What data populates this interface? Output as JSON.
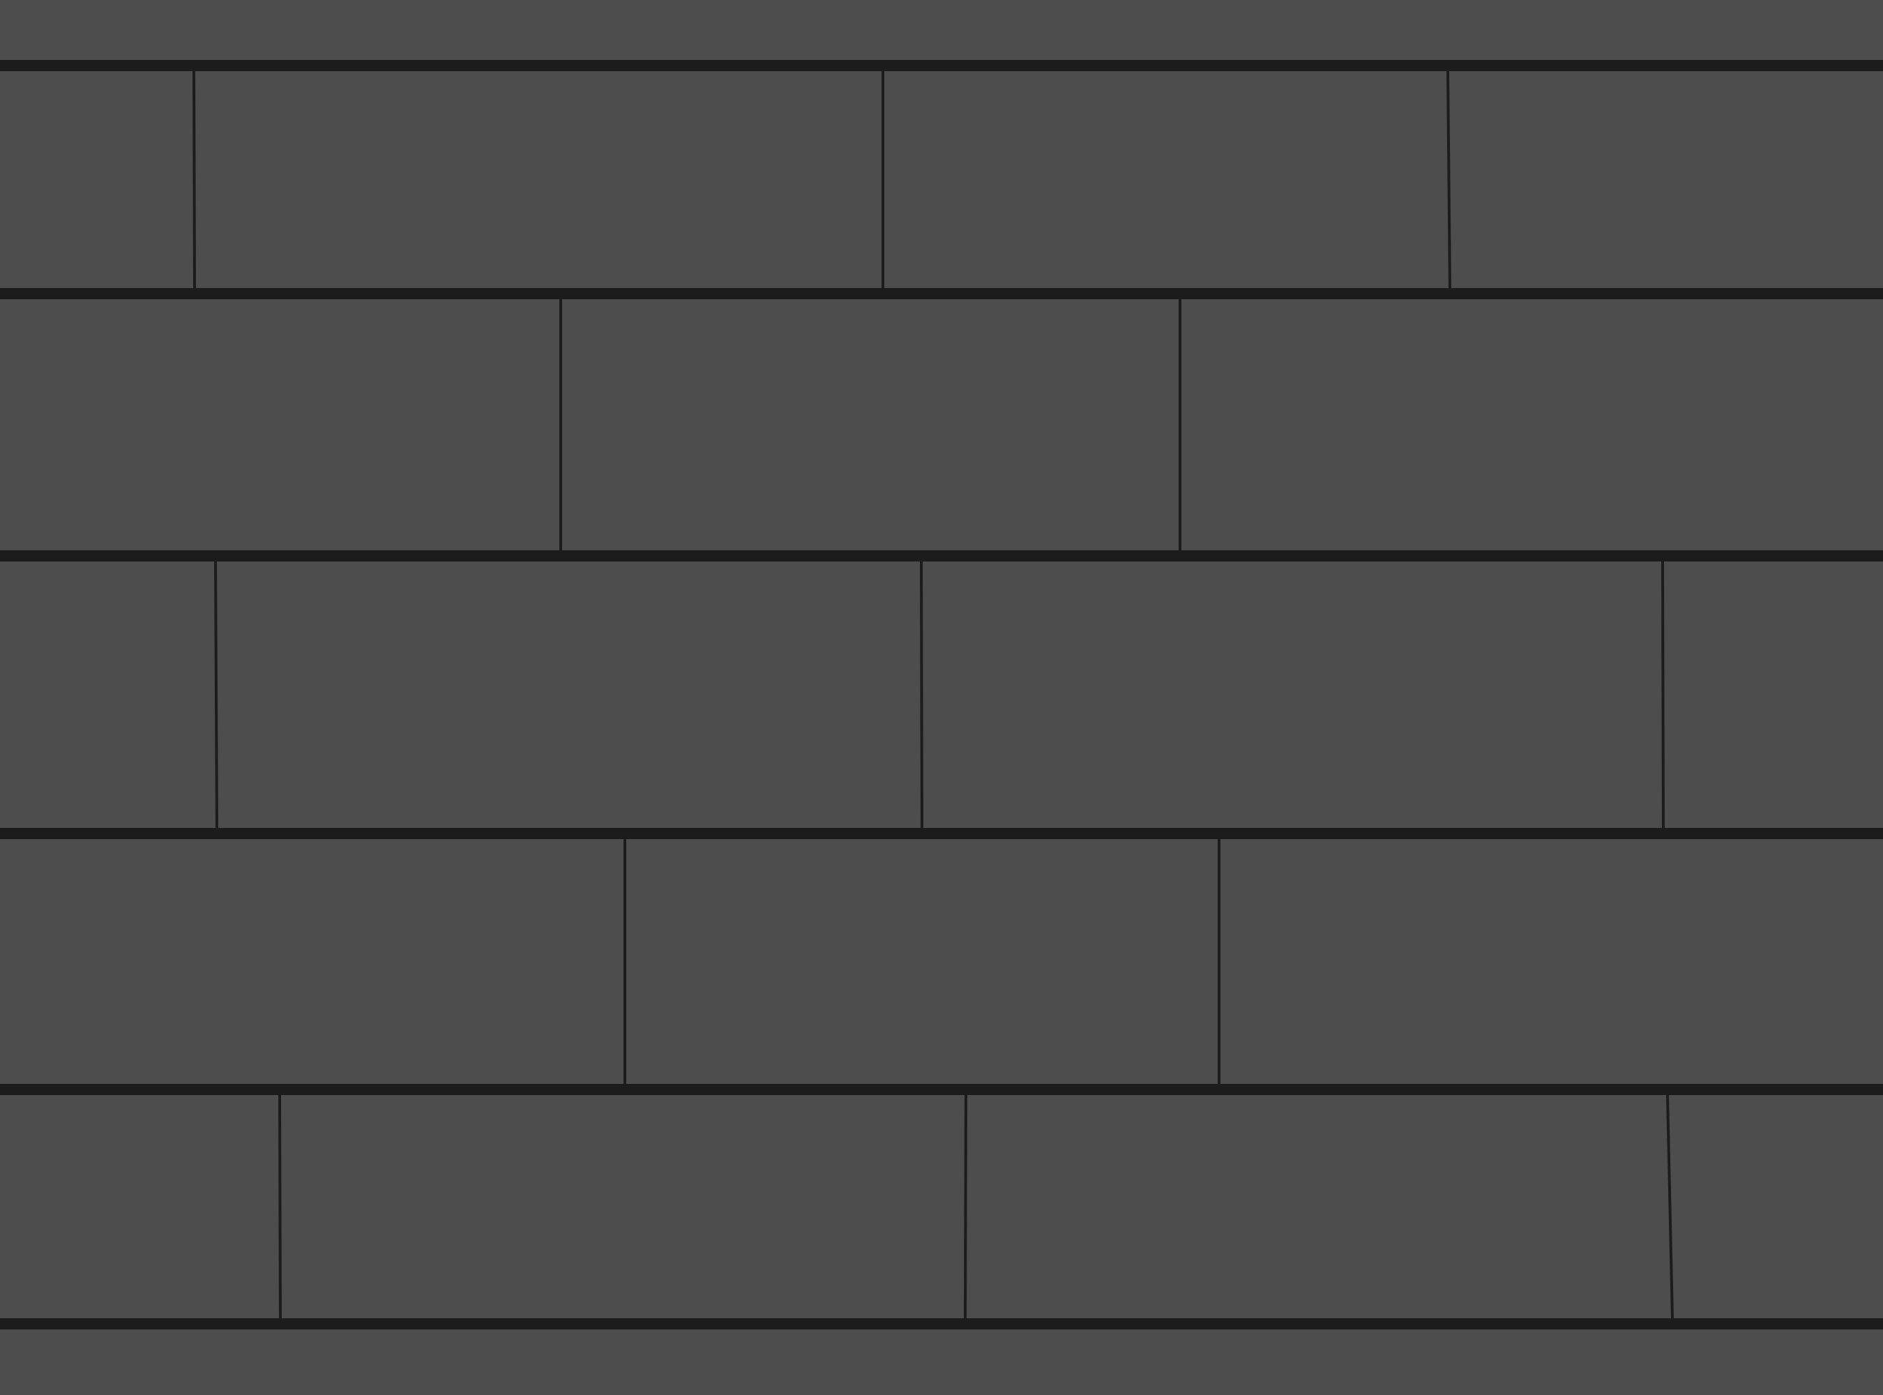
{
  "colors": {
    "tile": "#4d4d4d",
    "grout": "#1c1c1c"
  },
  "pattern": "running-bond-tile"
}
